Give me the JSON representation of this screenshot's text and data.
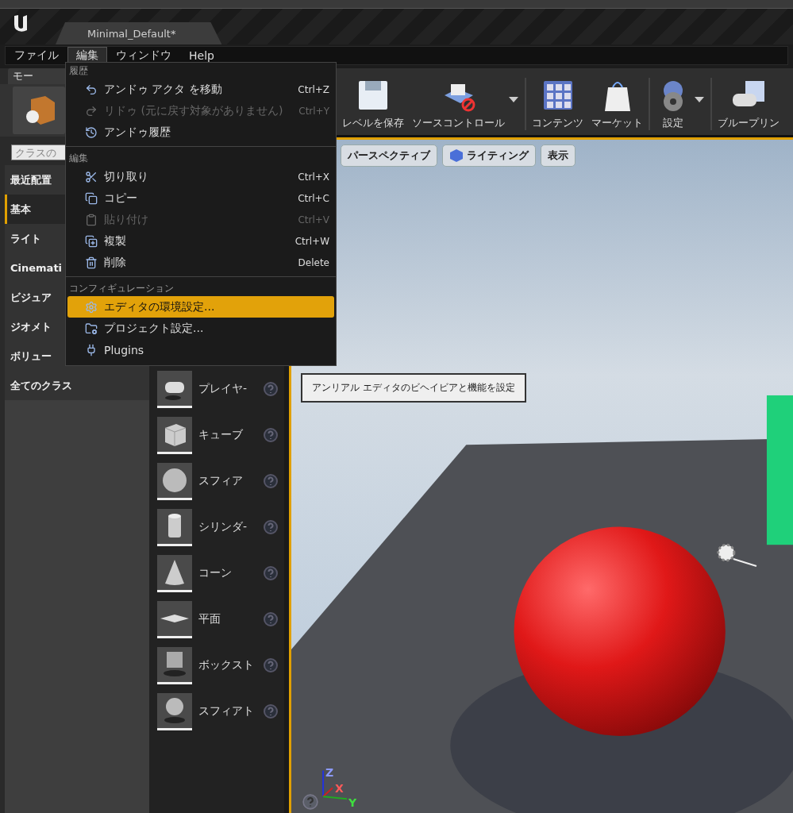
{
  "title_bar": {
    "tab": "Minimal_Default*"
  },
  "menu_bar": [
    {
      "label": "ファイル",
      "selected": false
    },
    {
      "label": "編集",
      "selected": true
    },
    {
      "label": "ウィンドウ",
      "selected": false
    },
    {
      "label": "Help",
      "selected": false
    }
  ],
  "edit_menu": [
    {
      "header": "履歴",
      "items": [
        {
          "label": "アンドゥ アクタ を移動",
          "shortcut": "Ctrl+Z",
          "disabled": false,
          "selected": false
        },
        {
          "label": "リドゥ (元に戻す対象がありません)",
          "shortcut": "Ctrl+Y",
          "disabled": true,
          "selected": false
        },
        {
          "label": "アンドゥ履歴",
          "disabled": false,
          "selected": false
        }
      ]
    },
    {
      "header": "編集",
      "items": [
        {
          "label": "切り取り",
          "shortcut": "Ctrl+X",
          "disabled": false,
          "selected": false
        },
        {
          "label": "コピー",
          "shortcut": "Ctrl+C",
          "disabled": false,
          "selected": false
        },
        {
          "label": "貼り付け",
          "shortcut": "Ctrl+V",
          "disabled": true,
          "selected": false
        },
        {
          "label": "複製",
          "shortcut": "Ctrl+W",
          "disabled": false,
          "selected": false
        },
        {
          "label": "削除",
          "shortcut": "Delete",
          "disabled": false,
          "selected": false
        }
      ]
    },
    {
      "header": "コンフィギュレーション",
      "items": [
        {
          "label": "エディタの環境設定...",
          "disabled": false,
          "selected": true
        },
        {
          "label": "プロジェクト設定...",
          "disabled": false,
          "selected": false
        },
        {
          "label": "Plugins",
          "disabled": false,
          "selected": false
        }
      ]
    }
  ],
  "modes_panel": {
    "tab": "モー",
    "search": {
      "placeholder": "クラスの"
    },
    "categories": [
      {
        "label": "最近配置",
        "selected": false
      },
      {
        "label": "基本",
        "selected": true
      },
      {
        "label": "ライト",
        "selected": false
      },
      {
        "label": "Cinemati",
        "selected": false
      },
      {
        "label": "ビジュア",
        "selected": false
      },
      {
        "label": "ジオメト",
        "selected": false
      },
      {
        "label": "ボリュー",
        "selected": false
      },
      {
        "label": "全てのクラス",
        "selected": false
      }
    ],
    "items": [
      {
        "label": "プレイヤ-"
      },
      {
        "label": "キューブ"
      },
      {
        "label": "スフィア"
      },
      {
        "label": "シリンダ-"
      },
      {
        "label": "コーン"
      },
      {
        "label": "平面"
      },
      {
        "label": "ボックスト"
      },
      {
        "label": "スフィアト"
      }
    ]
  },
  "toolbar": [
    {
      "label": "レベルを保存",
      "dropdown": false
    },
    {
      "label": "ソースコントロール",
      "dropdown": true
    },
    {
      "label": "コンテンツ",
      "dropdown": false
    },
    {
      "label": "マーケット",
      "dropdown": false
    },
    {
      "label": "設定",
      "dropdown": true
    },
    {
      "label": "ブループリン",
      "dropdown": false
    }
  ],
  "viewport": {
    "buttons": [
      "パースペクティブ",
      "ライティング",
      "表示"
    ],
    "tooltip": "アンリアル エディタのビヘイビアと機能を設定",
    "gizmo_axes": [
      "Z",
      "X",
      "Y"
    ]
  }
}
